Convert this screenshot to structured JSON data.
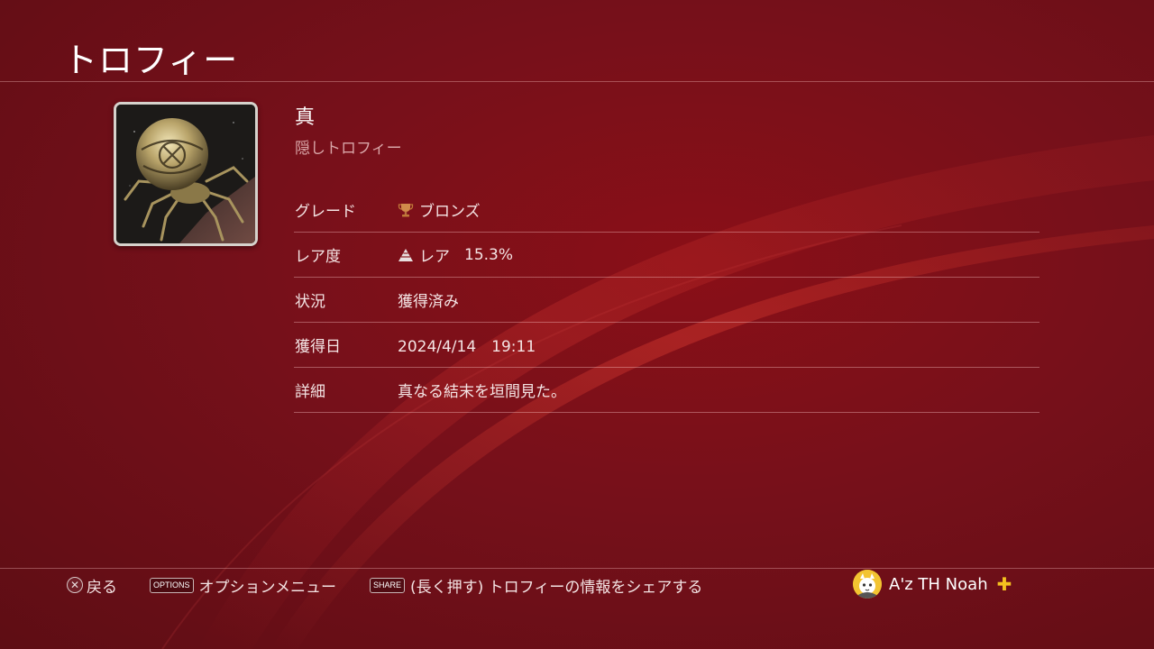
{
  "header": {
    "title": "トロフィー"
  },
  "trophy": {
    "name": "真",
    "subtitle": "隠しトロフィー",
    "image_icon": "spider-mech-trophy-art",
    "details": {
      "grade_label": "グレード",
      "grade_value": "ブロンズ",
      "grade_icon": "bronze-trophy-icon",
      "rarity_label": "レア度",
      "rarity_value": "レア",
      "rarity_percent": "15.3%",
      "rarity_icon": "rarity-pyramid-icon",
      "status_label": "状況",
      "status_value": "獲得済み",
      "earned_label": "獲得日",
      "earned_value": "2024/4/14　19:11",
      "detail_label": "詳細",
      "detail_value": "真なる結末を垣間見た。"
    }
  },
  "footer": {
    "back_label": "戻る",
    "options_key": "OPTIONS",
    "options_label": "オプションメニュー",
    "share_key": "SHARE",
    "share_label": "(長く押す) トロフィーの情報をシェアする"
  },
  "user": {
    "name": "A'z TH Noah",
    "plus_icon": "ps-plus-icon"
  },
  "colors": {
    "background": "#76101a",
    "plus": "#f4c21f"
  }
}
